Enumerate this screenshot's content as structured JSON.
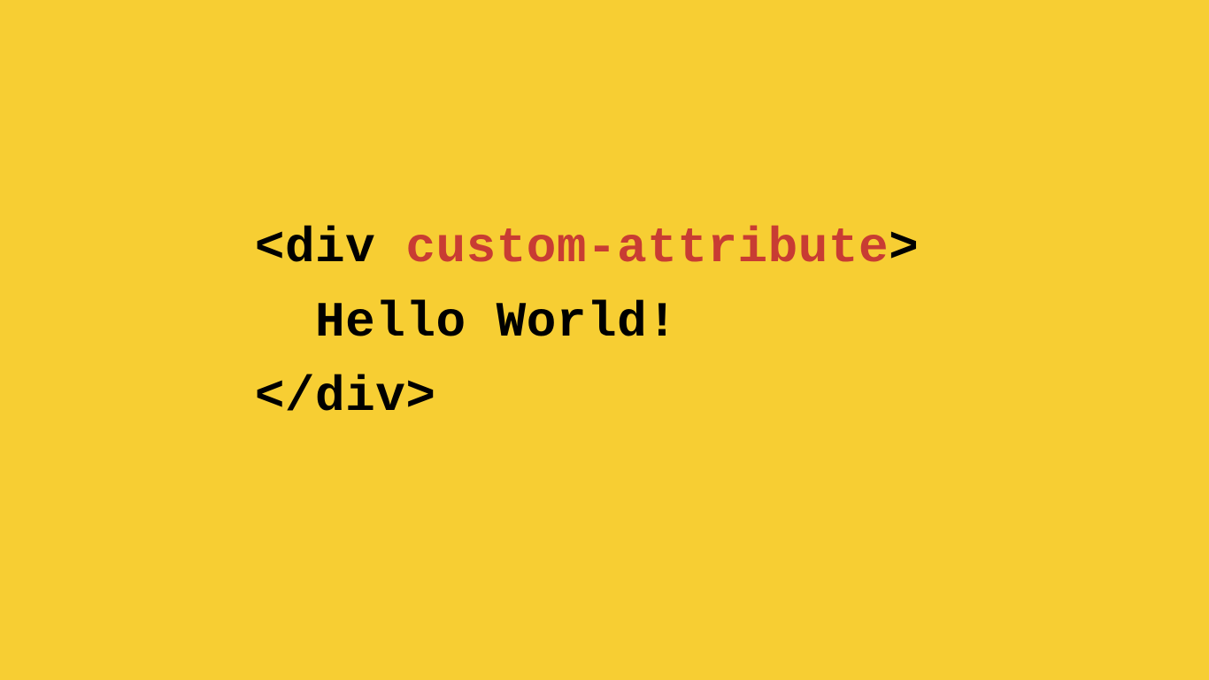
{
  "code": {
    "line1": {
      "open_bracket": "<",
      "tag": "div",
      "space": " ",
      "attribute": "custom-attribute",
      "close_bracket": ">"
    },
    "line2": {
      "indent": "  ",
      "content": "Hello World!"
    },
    "line3": {
      "close_tag": "</div>"
    }
  },
  "colors": {
    "background": "#f7ce33",
    "text": "#000000",
    "attribute": "#c83c33"
  }
}
